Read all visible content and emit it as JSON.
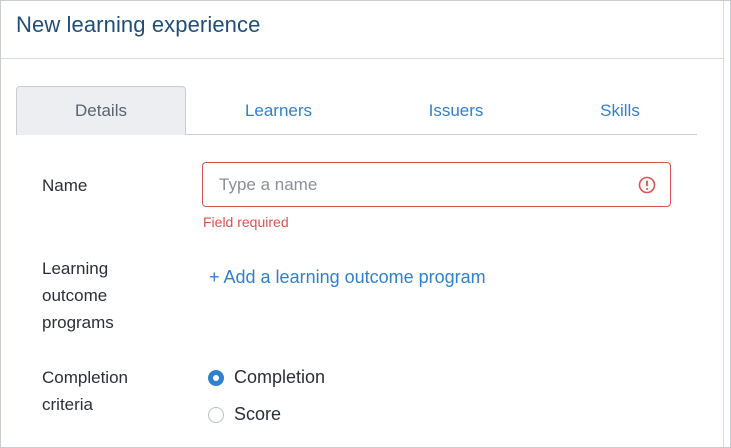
{
  "header": {
    "title": "New learning experience"
  },
  "tabs": [
    {
      "label": "Details",
      "active": true
    },
    {
      "label": "Learners",
      "active": false
    },
    {
      "label": "Issuers",
      "active": false
    },
    {
      "label": "Skills",
      "active": false
    }
  ],
  "form": {
    "name": {
      "label": "Name",
      "placeholder": "Type a name",
      "value": "",
      "error": "Field required",
      "error_icon": "exclamation-circle-icon"
    },
    "learning_outcome_programs": {
      "label": "Learning outcome programs",
      "add_link": "+ Add a learning outcome program"
    },
    "completion_criteria": {
      "label": "Completion criteria",
      "options": [
        {
          "label": "Completion",
          "selected": true
        },
        {
          "label": "Score",
          "selected": false
        }
      ]
    }
  },
  "colors": {
    "title": "#1f4e79",
    "accent": "#2f80d1",
    "error": "#d9534f",
    "active_tab_bg": "#eceef1"
  }
}
